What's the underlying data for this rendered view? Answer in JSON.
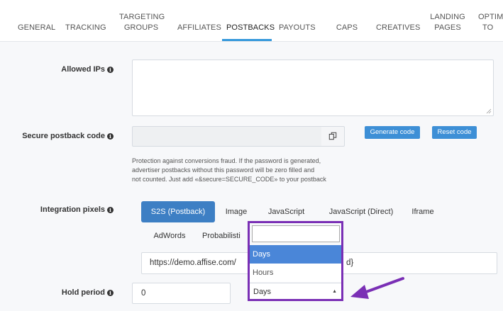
{
  "tabs": [
    {
      "label": "GENERAL"
    },
    {
      "label": "TRACKING"
    },
    {
      "label": "TARGETING GROUPS",
      "line1": "TARGETING",
      "line2": "GROUPS"
    },
    {
      "label": "AFFILIATES"
    },
    {
      "label": "POSTBACKS",
      "active": true
    },
    {
      "label": "PAYOUTS"
    },
    {
      "label": "CAPS"
    },
    {
      "label": "CREATIVES"
    },
    {
      "label": "LANDING PAGES",
      "line1": "LANDING",
      "line2": "PAGES"
    },
    {
      "label": "OPTIMI... TO...",
      "line1": "OPTIM",
      "line2": "TO"
    }
  ],
  "form": {
    "allowed_ips": {
      "label": "Allowed IPs",
      "value": ""
    },
    "secure_code": {
      "label": "Secure postback code",
      "value": "",
      "generate_label": "Generate code",
      "reset_label": "Reset code",
      "help": "Protection against conversions fraud. If the password is generated, advertiser postbacks without this password will be zero filled and not counted. Just add «&secure=SECURE_CODE» to your postback",
      "help_lines": [
        "Protection against conversions fraud. If the password is generated,",
        "advertiser postbacks without this password will be zero filled and",
        "not counted. Just add «&secure=SECURE_CODE» to your postback"
      ]
    },
    "integration": {
      "label": "Integration pixels",
      "options": [
        "S2S (Postback)",
        "Image",
        "JavaScript",
        "JavaScript (Direct)",
        "Iframe",
        "AdWords",
        "Probabilisti"
      ],
      "active": "S2S (Postback)",
      "url_left": "https://demo.affise.com/",
      "url_right": "d}"
    },
    "hold_period": {
      "label": "Hold period",
      "value": "0",
      "unit": "Days"
    }
  },
  "dropdown": {
    "search_value": "",
    "options": [
      {
        "label": "Days",
        "highlighted": true
      },
      {
        "label": "Hours",
        "highlighted": false
      }
    ],
    "selected": "Days"
  },
  "colors": {
    "accent": "#3d8fd6",
    "active_pill": "#3d7fc4",
    "highlight_border": "#7a2fb5",
    "arrow": "#7a2fb5"
  }
}
